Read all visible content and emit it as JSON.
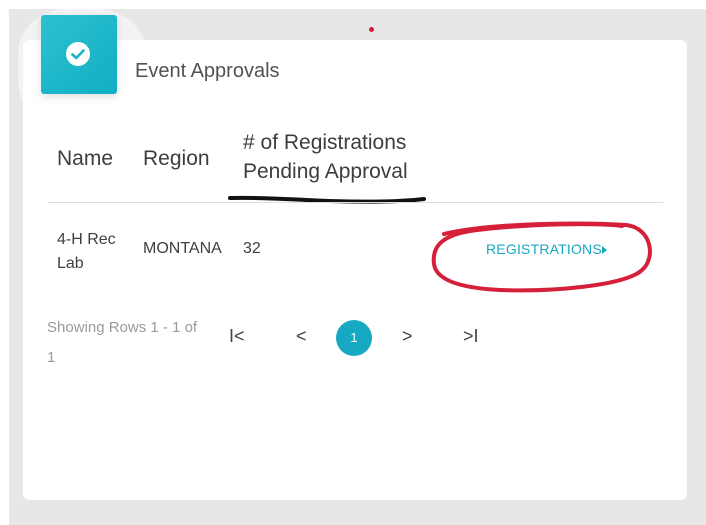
{
  "card": {
    "title": "Event Approvals"
  },
  "table": {
    "columns": {
      "name": "Name",
      "region": "Region",
      "pending_line1": "# of Registrations",
      "pending_line2": "Pending Approval"
    },
    "rows": [
      {
        "name": "4-H Rec Lab",
        "region": "MONTANA",
        "count": "32",
        "action_label": "REGISTRATIONS"
      }
    ]
  },
  "pagination": {
    "rows_info": "Showing Rows 1 - 1 of 1",
    "first": "I<",
    "prev": "<",
    "current": "1",
    "next": ">",
    "last": ">I"
  },
  "colors": {
    "accent": "#17a8c2",
    "annotation_red": "#d6203a",
    "annotation_black": "#111111"
  }
}
